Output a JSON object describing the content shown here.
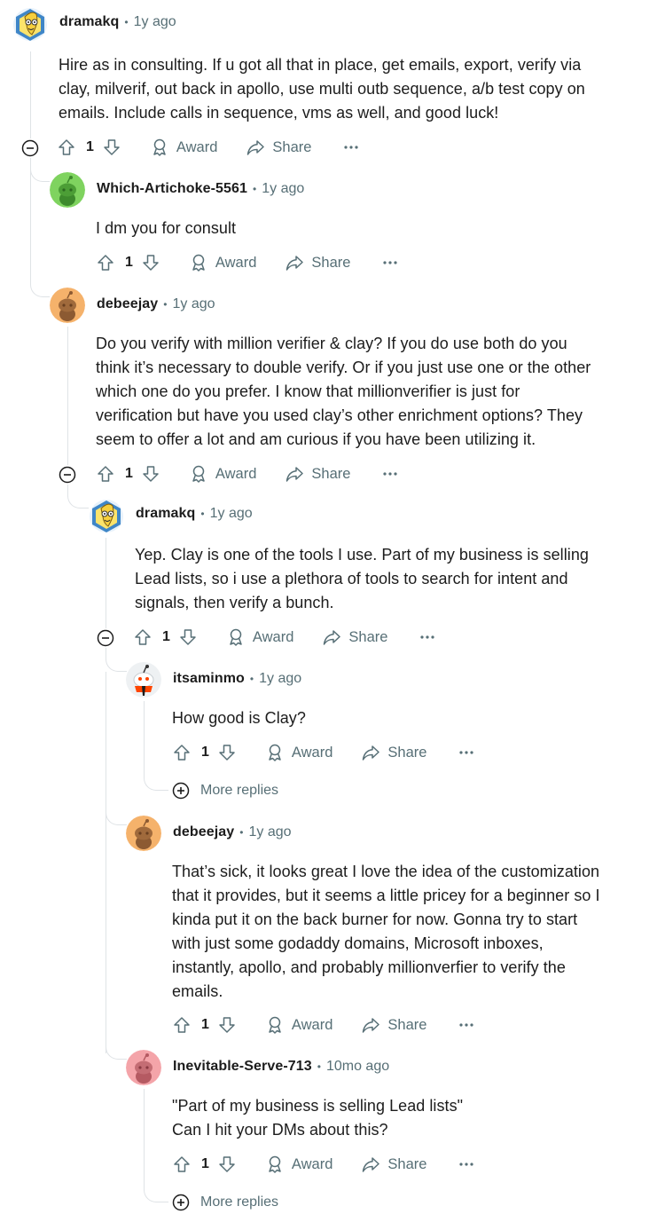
{
  "ui": {
    "colors": {
      "text": "#1c1c1c",
      "muted": "#576f76",
      "line": "#dfe3e6"
    },
    "labels": {
      "award": "Award",
      "share": "Share",
      "more_replies": "More replies",
      "separator": "•"
    }
  },
  "comments": [
    {
      "author": "dramakq",
      "time": "1y ago",
      "avatar": "banana-avatar-icon",
      "lines": [
        "Hire as in consulting. If u got all that in place, get emails, export, verify via",
        "clay, milverif, out back in apollo, use multi outb sequence, a/b test copy on",
        "emails. Include calls in sequence, vms as well, and good luck!"
      ],
      "votes": "1"
    },
    {
      "author": "Which-Artichoke-5561",
      "time": "1y ago",
      "avatar": "snoo-green-avatar-icon",
      "lines": [
        "I dm you for consult"
      ],
      "votes": "1"
    },
    {
      "author": "debeejay",
      "time": "1y ago",
      "avatar": "snoo-orange-avatar-icon",
      "lines": [
        "Do you verify with million verifier & clay? If you do use both do you",
        "think it’s necessary to double verify. Or if you just use one or the other",
        "which one do you prefer. I know that millionverifier is just for",
        "verification but have you used clay’s other enrichment options? They",
        "seem to offer a lot and am curious if you have been utilizing it."
      ],
      "votes": "1"
    },
    {
      "author": "dramakq",
      "time": "1y ago",
      "avatar": "banana-avatar-icon",
      "lines": [
        "Yep. Clay is one of the tools I use. Part of my business is selling",
        "Lead lists, so i use a plethora of tools to search for intent and",
        "signals, then verify a bunch."
      ],
      "votes": "1"
    },
    {
      "author": "itsaminmo",
      "time": "1y ago",
      "avatar": "snoo-scarf-avatar-icon",
      "lines": [
        "How good is Clay?"
      ],
      "votes": "1"
    },
    {
      "author": "debeejay",
      "time": "1y ago",
      "avatar": "snoo-orange-avatar-icon",
      "lines": [
        "That’s sick, it looks great I love the idea of the customization",
        "that it provides, but it seems a little pricey for a beginner so I",
        "kinda put it on the back burner for now. Gonna try to start",
        "with just some godaddy domains, Microsoft inboxes,",
        "instantly, apollo, and probably millionverfier to verify the",
        "emails."
      ],
      "votes": "1"
    },
    {
      "author": "Inevitable-Serve-713",
      "time": "10mo ago",
      "avatar": "snoo-pink-avatar-icon",
      "lines": [
        "\"Part of my business is selling Lead lists\"",
        "Can I hit your DMs about this?"
      ],
      "votes": "1"
    }
  ]
}
